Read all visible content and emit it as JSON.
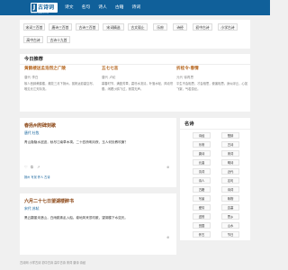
{
  "header": {
    "logo_mark": "J",
    "logo_text": "古诗词",
    "logo_sub": "GUSHICIWANG.COM",
    "nav": [
      "诗文",
      "名句",
      "诗人",
      "古籍",
      "诗词"
    ]
  },
  "tags": [
    "宋词三百首",
    "唐诗三百首",
    "古诗三百首",
    "宋词精选",
    "古文观止",
    "乐府",
    "诗经",
    "初中古诗",
    "小学古诗",
    "高中古诗",
    "古诗十九首"
  ],
  "recommend": {
    "title": "今日推荐",
    "items": [
      {
        "title": "黄鹤楼送孟浩然之广陵",
        "meta": "唐代  李白",
        "text": "故人西辞黄鹤楼，烟花三月下扬州。孤帆远影碧空尽，唯见长江天际流。"
      },
      {
        "title": "五七七言",
        "meta": "唐代  卢纶",
        "text": "暮春时节，满庭芳草，霜尽水流清。叶落水轻，风动帘垂。闲看沙鸥飞过，寂寞无声。"
      },
      {
        "title": "折桂令·春情",
        "meta": "元代  徐再思",
        "text": "平生不会相思，才会相思，便害相思。身似浮云，心如飞絮，气若游丝。"
      }
    ]
  },
  "poems": [
    {
      "title": "春扬州附碑刻歌",
      "meta": "唐代  杜牧",
      "content": "青山隐隐水迢迢，秋尽江南草木凋。二十四桥明月夜，玉人何处教吹箫？",
      "tags": "扬州  写景  怀人  古诗"
    },
    {
      "title": "六月二十七日望湖楼醉书",
      "meta": "宋代  苏轼",
      "content": "黑云翻墨未遮山，白雨跳珠乱入船。卷地风来忽吹散，望湖楼下水如天。",
      "tags": "宋词  写景  西湖  古诗"
    }
  ],
  "sidebar": {
    "title": "名诗",
    "items": [
      "诗经",
      "楚辞",
      "乐府",
      "古诗",
      "唐诗",
      "宋词",
      "元曲",
      "明诗",
      "清词",
      "近代",
      "诗人",
      "名句",
      "古籍",
      "诗词",
      "写景",
      "咏物",
      "爱情",
      "边塞",
      "送别",
      "思乡",
      "田园",
      "山水",
      "怀古",
      "节日"
    ]
  },
  "footer": "古诗网  小学古诗  初中古诗  高中古诗  宋词  唐诗  诗经"
}
